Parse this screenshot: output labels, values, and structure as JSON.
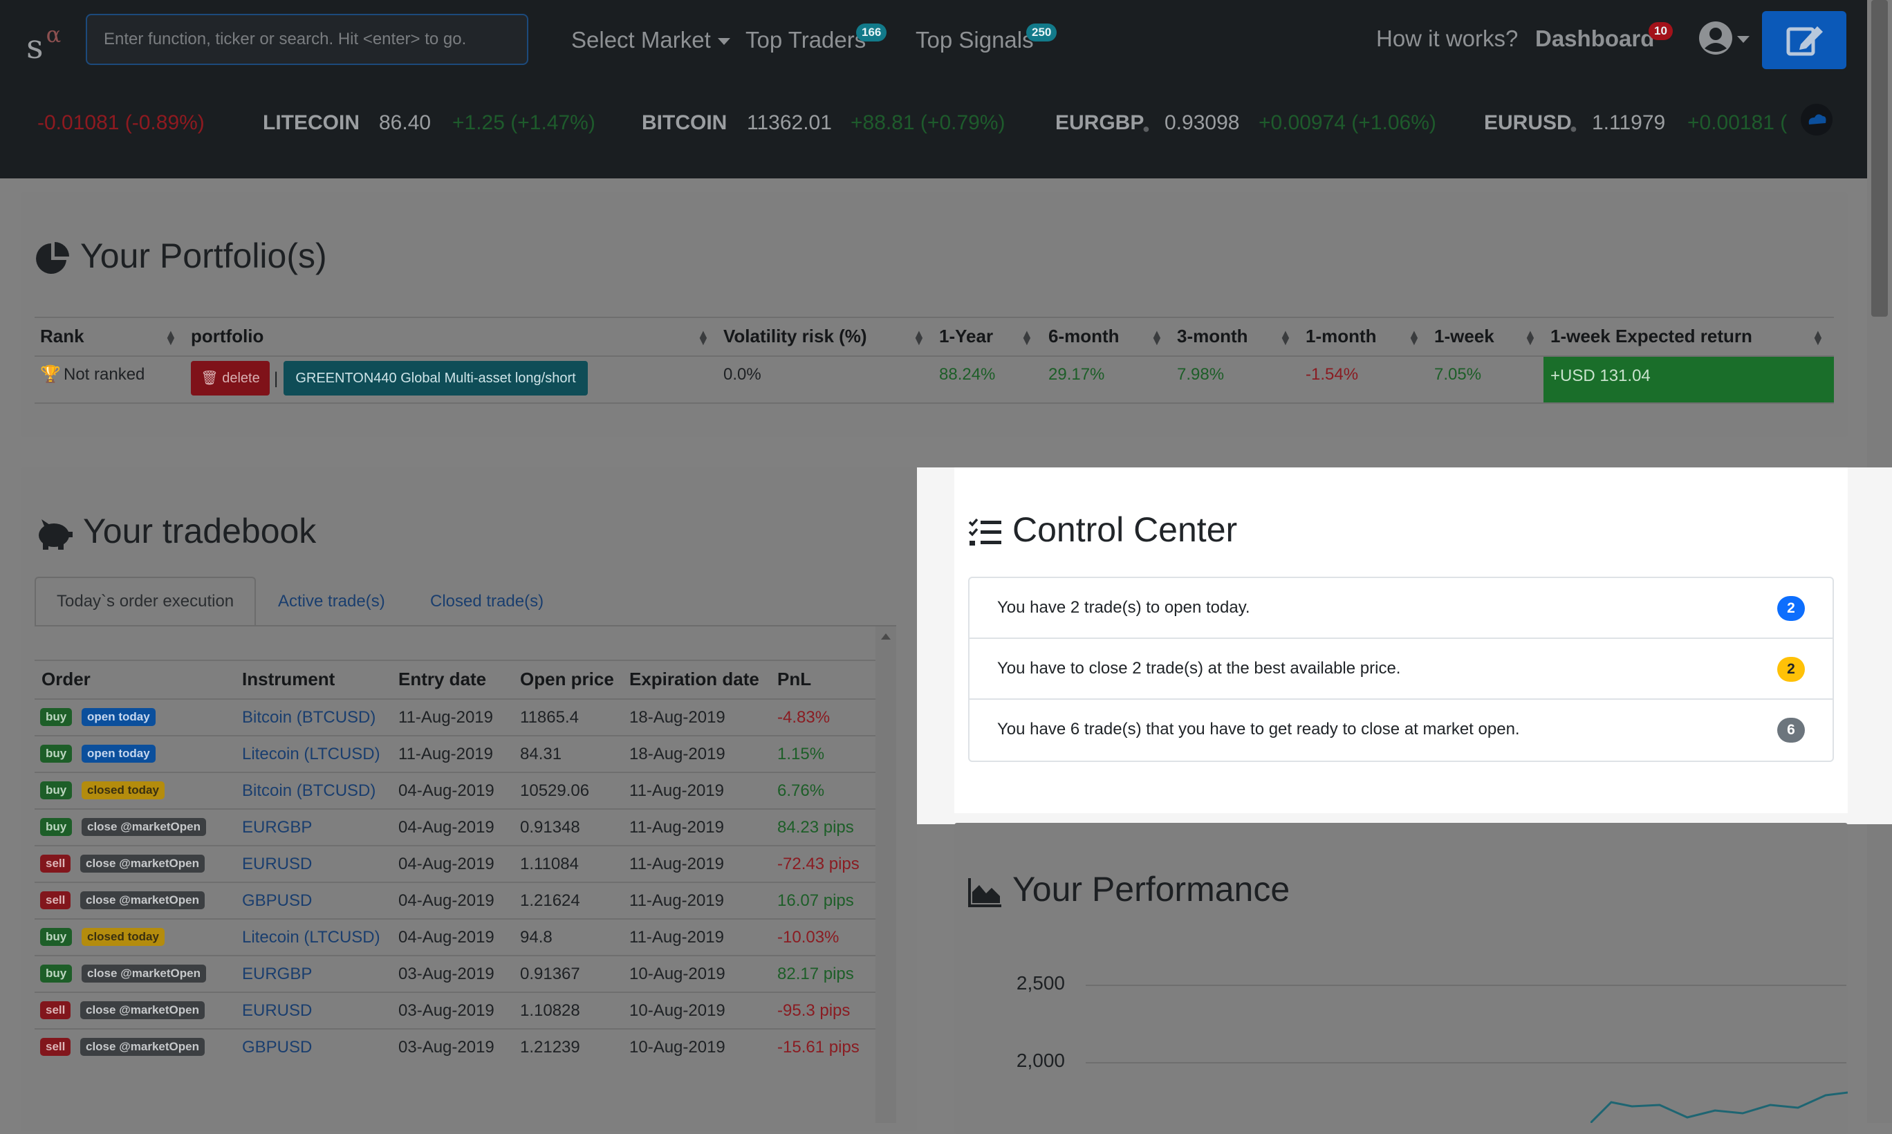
{
  "nav": {
    "logo": "s",
    "logo_sup": "α",
    "search_placeholder": "Enter function, ticker or search. Hit <enter> to go.",
    "select_market": "Select Market",
    "top_traders": "Top Traders",
    "top_traders_count": "166",
    "top_signals": "Top Signals",
    "top_signals_count": "250",
    "how_it_works": "How it works?",
    "dashboard": "Dashboard",
    "dashboard_count": "10"
  },
  "ticker": [
    {
      "name": "",
      "price": "",
      "change": "-0.01081 (-0.89%)",
      "dir": "neg"
    },
    {
      "name": "LITECOIN",
      "price": "86.40",
      "change": "+1.25 (+1.47%)",
      "dir": "pos"
    },
    {
      "name": "BITCOIN",
      "price": "11362.01",
      "change": "+88.81 (+0.79%)",
      "dir": "pos"
    },
    {
      "name": "EURGBP",
      "price": "0.93098",
      "change": "+0.00974 (+1.06%)",
      "dir": "pos"
    },
    {
      "name": "EURUSD",
      "price": "1.11979",
      "change": "+0.00181 (",
      "dir": "pos"
    }
  ],
  "portfolio": {
    "title": "Your Portfolio(s)",
    "columns": [
      "Rank",
      "portfolio",
      "Volatility risk (%)",
      "1-Year",
      "6-month",
      "3-month",
      "1-month",
      "1-week",
      "1-week Expected return"
    ],
    "row": {
      "rank": "Not ranked",
      "delete_label": "delete",
      "separator": "|",
      "portfolio_name": "GREENTON440 Global Multi-asset long/short",
      "volatility": "0.0%",
      "y1": "88.24%",
      "m6": "29.17%",
      "m3": "7.98%",
      "m1": "-1.54%",
      "w1": "7.05%",
      "expected": "+USD 131.04"
    }
  },
  "tradebook": {
    "title": "Your tradebook",
    "tabs": [
      "Today`s order execution",
      "Active trade(s)",
      "Closed trade(s)"
    ],
    "columns": [
      "Order",
      "Instrument",
      "Entry date",
      "Open price",
      "Expiration date",
      "PnL"
    ],
    "rows": [
      {
        "side": "buy",
        "status": "open today",
        "instrument": "Bitcoin (BTCUSD)",
        "entry": "11-Aug-2019",
        "open": "11865.4",
        "expiry": "18-Aug-2019",
        "pnl": "-4.83%"
      },
      {
        "side": "buy",
        "status": "open today",
        "instrument": "Litecoin (LTCUSD)",
        "entry": "11-Aug-2019",
        "open": "84.31",
        "expiry": "18-Aug-2019",
        "pnl": "1.15%"
      },
      {
        "side": "buy",
        "status": "closed today",
        "instrument": "Bitcoin (BTCUSD)",
        "entry": "04-Aug-2019",
        "open": "10529.06",
        "expiry": "11-Aug-2019",
        "pnl": "6.76%"
      },
      {
        "side": "buy",
        "status": "close @marketOpen",
        "instrument": "EURGBP",
        "entry": "04-Aug-2019",
        "open": "0.91348",
        "expiry": "11-Aug-2019",
        "pnl": "84.23 pips"
      },
      {
        "side": "sell",
        "status": "close @marketOpen",
        "instrument": "EURUSD",
        "entry": "04-Aug-2019",
        "open": "1.11084",
        "expiry": "11-Aug-2019",
        "pnl": "-72.43 pips"
      },
      {
        "side": "sell",
        "status": "close @marketOpen",
        "instrument": "GBPUSD",
        "entry": "04-Aug-2019",
        "open": "1.21624",
        "expiry": "11-Aug-2019",
        "pnl": "16.07 pips"
      },
      {
        "side": "buy",
        "status": "closed today",
        "instrument": "Litecoin (LTCUSD)",
        "entry": "04-Aug-2019",
        "open": "94.8",
        "expiry": "11-Aug-2019",
        "pnl": "-10.03%"
      },
      {
        "side": "buy",
        "status": "close @marketOpen",
        "instrument": "EURGBP",
        "entry": "03-Aug-2019",
        "open": "0.91367",
        "expiry": "10-Aug-2019",
        "pnl": "82.17 pips"
      },
      {
        "side": "sell",
        "status": "close @marketOpen",
        "instrument": "EURUSD",
        "entry": "03-Aug-2019",
        "open": "1.10828",
        "expiry": "10-Aug-2019",
        "pnl": "-95.3 pips"
      },
      {
        "side": "sell",
        "status": "close @marketOpen",
        "instrument": "GBPUSD",
        "entry": "03-Aug-2019",
        "open": "1.21239",
        "expiry": "10-Aug-2019",
        "pnl": "-15.61 pips"
      }
    ]
  },
  "control_center": {
    "title": "Control Center",
    "items": [
      {
        "text": "You have 2 trade(s) to open today.",
        "count": "2",
        "color": "#0d6efd"
      },
      {
        "text": "You have to close 2 trade(s) at the best available price.",
        "count": "2",
        "color": "#ffc107"
      },
      {
        "text": "You have 6 trade(s) that you have to get ready to close at market open.",
        "count": "6",
        "color": "#6c757d"
      }
    ]
  },
  "performance": {
    "title": "Your Performance",
    "y_ticks": [
      "2,500",
      "2,000"
    ]
  },
  "colors": {
    "positive": "#28a745",
    "negative": "#dc3545",
    "primary": "#0d6efd",
    "warning": "#ffc107"
  }
}
